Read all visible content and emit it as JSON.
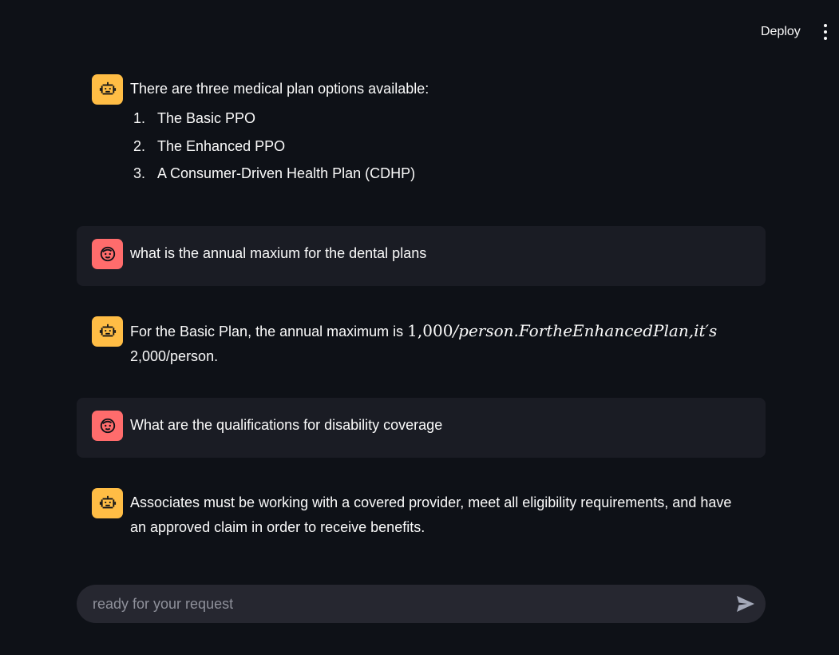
{
  "header": {
    "deploy_label": "Deploy",
    "menu_icon": "vertical-dots-icon"
  },
  "messages": [
    {
      "role": "assistant",
      "avatar_icon": "robot-icon",
      "text": "There are three medical plan options available:",
      "list": [
        {
          "num": "1.",
          "text": "The Basic PPO"
        },
        {
          "num": "2.",
          "text": "The Enhanced PPO"
        },
        {
          "num": "3.",
          "text": "A Consumer-Driven Health Plan (CDHP)"
        }
      ]
    },
    {
      "role": "user",
      "avatar_icon": "face-icon",
      "text": "what is the annual maxium for the dental plans"
    },
    {
      "role": "assistant",
      "avatar_icon": "robot-icon",
      "text_before_math": "For the Basic Plan, the annual maximum is ",
      "math_number": "1,000",
      "math_italic": "/person.FortheEnhancedPlan,it′s",
      "text_after_math": "2,000/person."
    },
    {
      "role": "user",
      "avatar_icon": "face-icon",
      "text": "What are the qualifications for disability coverage"
    },
    {
      "role": "assistant",
      "avatar_icon": "robot-icon",
      "text": "Associates must be working with a covered provider, meet all eligibility requirements, and have an approved claim in order to receive benefits."
    }
  ],
  "chat_input": {
    "placeholder": "ready for your request",
    "value": "",
    "send_icon": "send-icon"
  },
  "colors": {
    "background": "#0e1117",
    "user_bubble": "#1a1c24",
    "bot_avatar": "#ffbd45",
    "user_avatar": "#ff6c6c",
    "input_bg": "#262730"
  }
}
